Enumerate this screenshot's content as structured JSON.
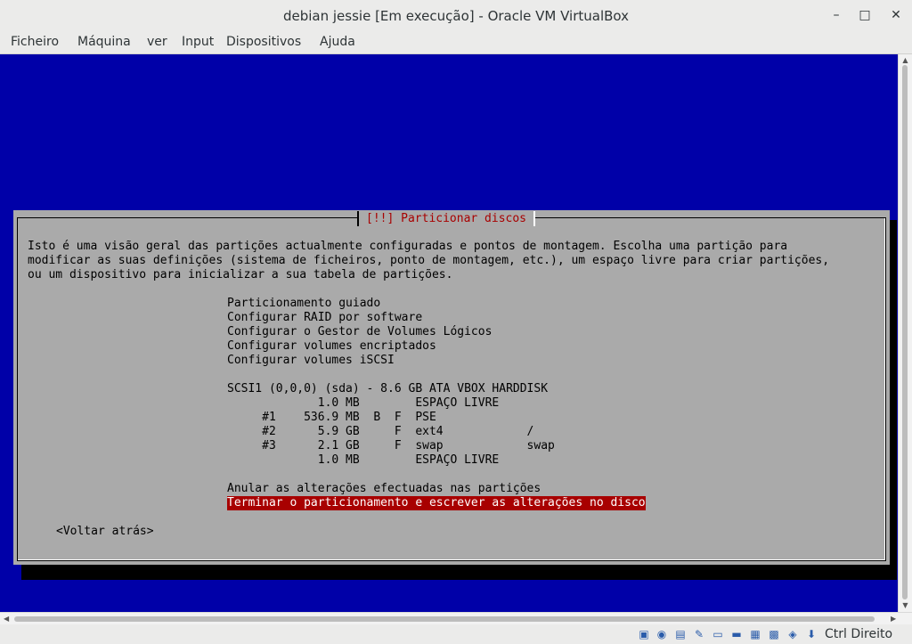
{
  "window": {
    "title": "debian jessie [Em execução] - Oracle VM VirtualBox",
    "minimize": "–",
    "maximize": "□",
    "close": "✕"
  },
  "menubar": {
    "items": [
      "Ficheiro",
      "Máquina",
      "ver",
      "Input",
      "Dispositivos",
      "Ajuda"
    ]
  },
  "installer": {
    "dialog_title": "[!!] Particionar discos",
    "description": [
      "Isto é uma visão geral das partições actualmente configuradas e pontos de montagem. Escolha uma partição para",
      "modificar as suas definições (sistema de ficheiros, ponto de montagem, etc.), um espaço livre para criar partições,",
      "ou um dispositivo para inicializar a sua tabela de partições."
    ],
    "options": [
      "Particionamento guiado",
      "Configurar RAID por software",
      "Configurar o Gestor de Volumes Lógicos",
      "Configurar volumes encriptados",
      "Configurar volumes iSCSI"
    ],
    "disk": "SCSI1 (0,0,0) (sda) - 8.6 GB ATA VBOX HARDDISK",
    "partitions": [
      "             1.0 MB        ESPAÇO LIVRE",
      "     #1    536.9 MB  B  F  PSE",
      "     #2      5.9 GB     F  ext4            /",
      "     #3      2.1 GB     F  swap            swap",
      "             1.0 MB        ESPAÇO LIVRE"
    ],
    "undo_changes": "Anular as alterações efectuadas nas partições",
    "finish": "Terminar o particionamento e escrever as alterações no disco",
    "back": "<Voltar atrás>"
  },
  "statusbar": {
    "icons": [
      "hard-disk-icon",
      "optical-drive-icon",
      "audio-icon",
      "usb-icon",
      "shared-folders-icon",
      "display-icon",
      "video-capture-icon",
      "network-icon",
      "mouse-integration-icon",
      "host-key-arrow-icon"
    ],
    "host_key": "Ctrl Direito"
  },
  "colors": {
    "vm_background": "#0000a8",
    "dialog_background": "#aaaaaa",
    "title_red": "#a80000",
    "selection_red": "#a80000"
  }
}
